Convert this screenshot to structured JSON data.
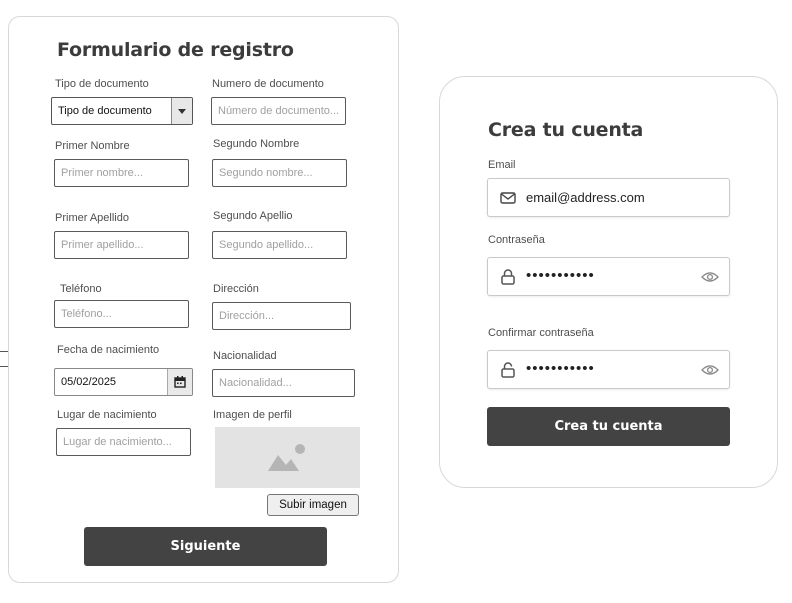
{
  "registration": {
    "title": "Formulario de registro",
    "doc_type_label": "Tipo de documento",
    "doc_type_value": "Tipo de documento",
    "doc_number_label": "Numero de documento",
    "doc_number_placeholder": "Número de documento...",
    "first_name_label": "Primer Nombre",
    "first_name_placeholder": "Primer nombre...",
    "second_name_label": "Segundo Nombre",
    "second_name_placeholder": "Segundo nombre...",
    "first_surname_label": "Primer Apellido",
    "first_surname_placeholder": "Primer apellido...",
    "second_surname_label": "Segundo Apellio",
    "second_surname_placeholder": "Segundo apellido...",
    "phone_label": "Teléfono",
    "phone_placeholder": "Teléfono...",
    "address_label": "Dirección",
    "address_placeholder": "Dirección...",
    "birth_date_label": "Fecha de nacimiento",
    "birth_date_value": "05/02/2025",
    "nationality_label": "Nacionalidad",
    "nationality_placeholder": "Nacionalidad...",
    "birth_place_label": "Lugar de nacimiento",
    "birth_place_placeholder": "Lugar de nacimiento...",
    "profile_image_label": "Imagen de perfil",
    "upload_button": "Subir imagen",
    "next_button": "Siguiente"
  },
  "account": {
    "title": "Crea tu cuenta",
    "email_label": "Email",
    "email_value": "email@address.com",
    "password_label": "Contraseña",
    "password_value": "•••••••••••",
    "confirm_label": "Confirmar contraseña",
    "confirm_value": "•••••••••••",
    "submit_button": "Crea tu cuenta"
  },
  "colors": {
    "button_dark": "#434343",
    "card_border": "#d8d8d8",
    "image_placeholder": "#e3e3e3"
  },
  "icons": [
    "chevron-down-icon",
    "calendar-icon",
    "image-icon",
    "mail-icon",
    "lock-icon",
    "unlock-icon",
    "eye-icon"
  ]
}
